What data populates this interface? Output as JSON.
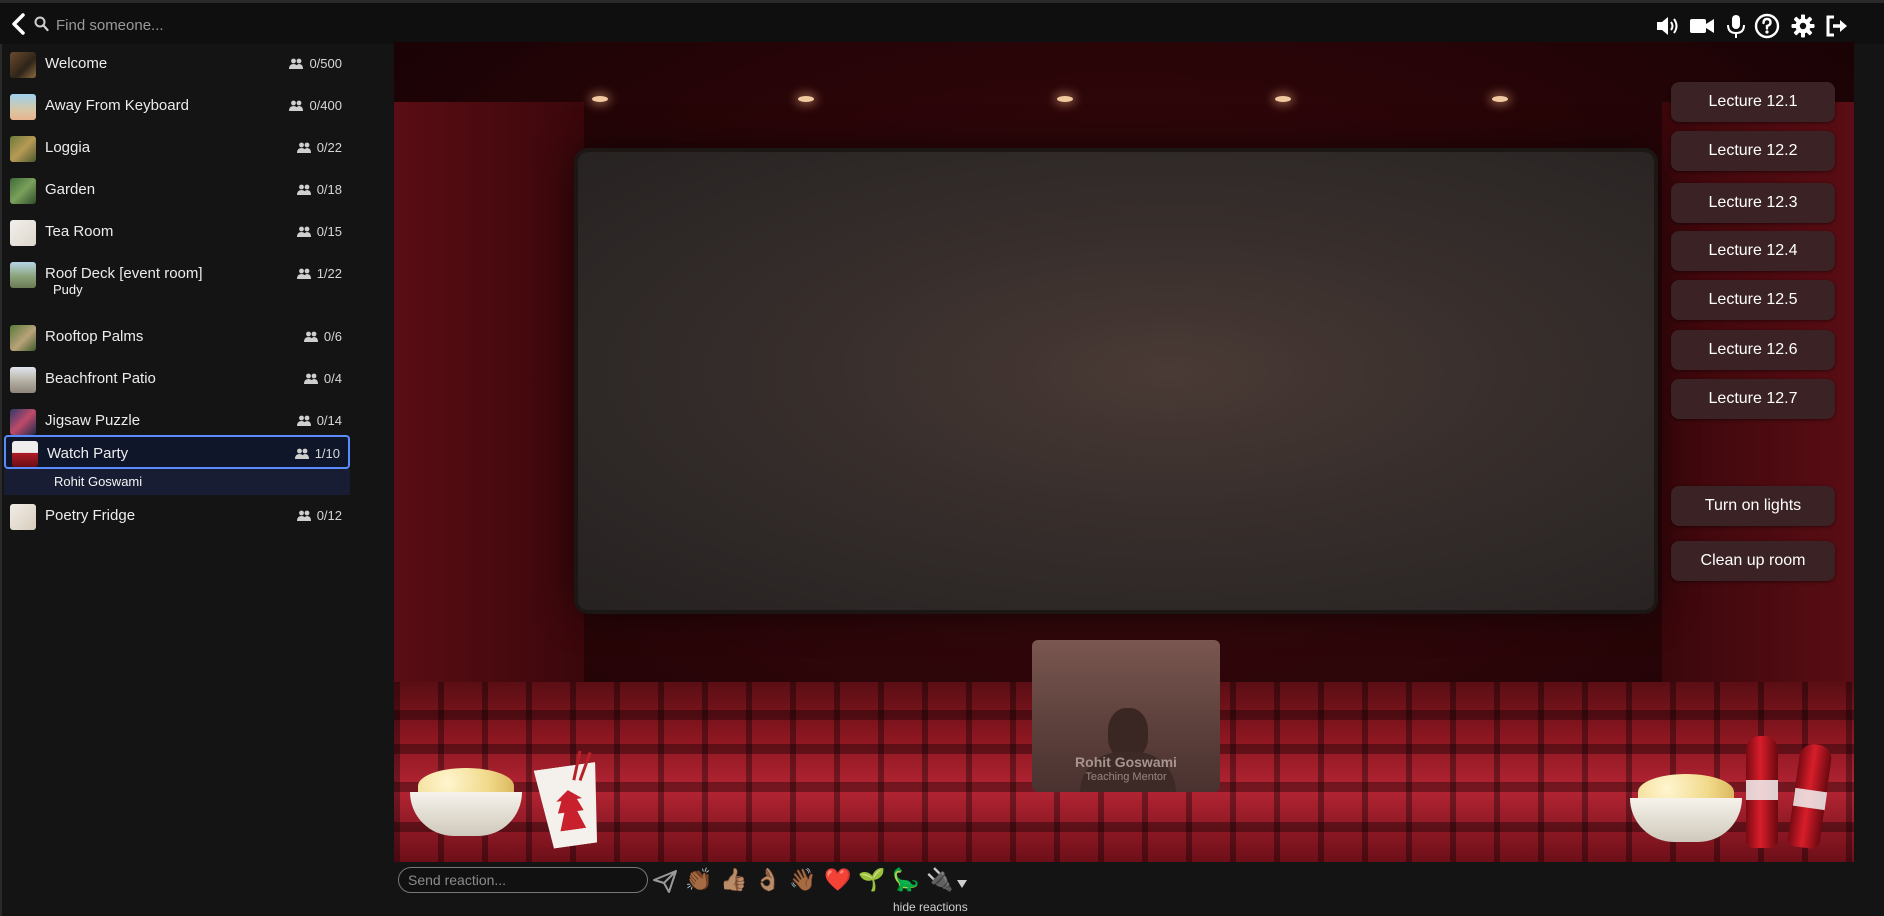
{
  "topbar": {
    "search_placeholder": "Find someone..."
  },
  "rooms": [
    {
      "name": "Welcome",
      "count": "0/500"
    },
    {
      "name": "Away From Keyboard",
      "count": "0/400"
    },
    {
      "name": "Loggia",
      "count": "0/22"
    },
    {
      "name": "Garden",
      "count": "0/18"
    },
    {
      "name": "Tea Room",
      "count": "0/15"
    },
    {
      "name": "Roof Deck [event room]",
      "count": "1/22",
      "occupant": "Pudy"
    },
    {
      "name": "Rooftop Palms",
      "count": "0/6"
    },
    {
      "name": "Beachfront Patio",
      "count": "0/4"
    },
    {
      "name": "Jigsaw Puzzle",
      "count": "0/14"
    },
    {
      "name": "Watch Party",
      "count": "1/10",
      "occupant": "Rohit Goswami",
      "selected": true
    },
    {
      "name": "Poetry Fridge",
      "count": "0/12"
    }
  ],
  "lectures": [
    "Lecture 12.1",
    "Lecture 12.2",
    "Lecture 12.3",
    "Lecture 12.4",
    "Lecture 12.5",
    "Lecture 12.6",
    "Lecture 12.7"
  ],
  "room_actions": {
    "lights": "Turn on lights",
    "clean": "Clean up room"
  },
  "video": {
    "name": "Rohit Goswami",
    "role": "Teaching Mentor"
  },
  "reactions": {
    "placeholder": "Send reaction...",
    "hide_label": "hide reactions",
    "emojis": [
      "👏🏾",
      "👍🏽",
      "👌🏽",
      "👋🏾",
      "❤️",
      "🌱",
      "🦕",
      "🔌"
    ]
  },
  "colors": {
    "selection_border": "#5a8cff",
    "lecture_button": "#3b2224",
    "seat_red": "#b32433"
  }
}
